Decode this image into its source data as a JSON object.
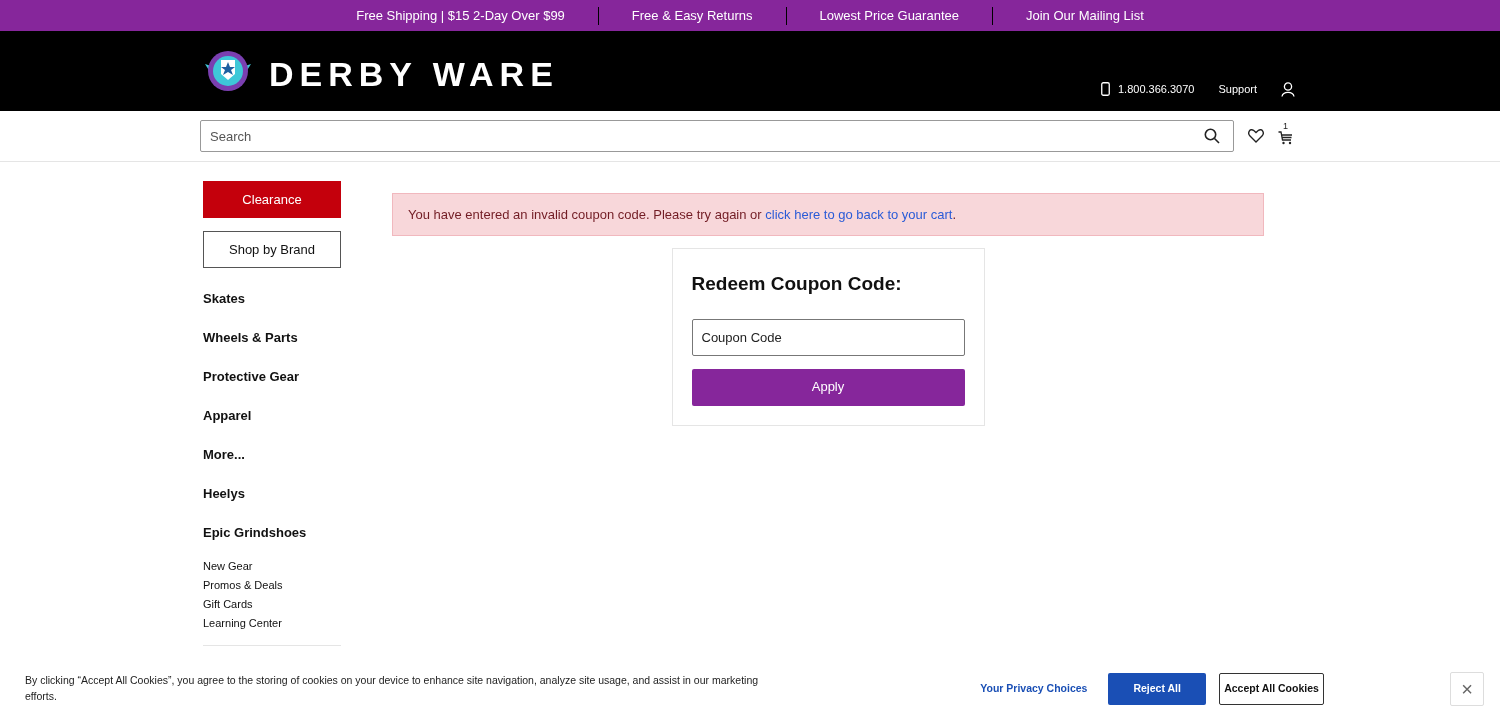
{
  "promo_bar": [
    "Free Shipping | $15 2-Day Over $99",
    "Free & Easy Returns",
    "Lowest Price Guarantee",
    "Join Our Mailing List"
  ],
  "header": {
    "logo_text": "DERBY WARE",
    "phone": "1.800.366.3070",
    "support": "Support"
  },
  "search": {
    "placeholder": "Search",
    "cart_count": "1"
  },
  "sidebar": {
    "buttons": [
      {
        "label": "Clearance",
        "kind": "primary"
      },
      {
        "label": "Shop by Brand",
        "kind": "outline"
      }
    ],
    "categories": [
      "Skates",
      "Wheels & Parts",
      "Protective Gear",
      "Apparel",
      "More...",
      "Heelys",
      "Epic Grindshoes"
    ],
    "links": [
      "New Gear",
      "Promos & Deals",
      "Gift Cards",
      "Learning Center"
    ]
  },
  "alert": {
    "text": "You have entered an invalid coupon code. Please try again or ",
    "link": "click here to go back to your cart",
    "end": "."
  },
  "coupon": {
    "title": "Redeem Coupon Code:",
    "placeholder": "Coupon Code",
    "button": "Apply"
  },
  "cookie_banner": {
    "text": "By clicking “Accept All Cookies”, you agree to the storing of cookies on your device to enhance site navigation, analyze site usage, and assist in our marketing efforts.",
    "privacy": "Your Privacy Choices",
    "reject": "Reject All",
    "accept": "Accept All Cookies",
    "close": "×"
  }
}
